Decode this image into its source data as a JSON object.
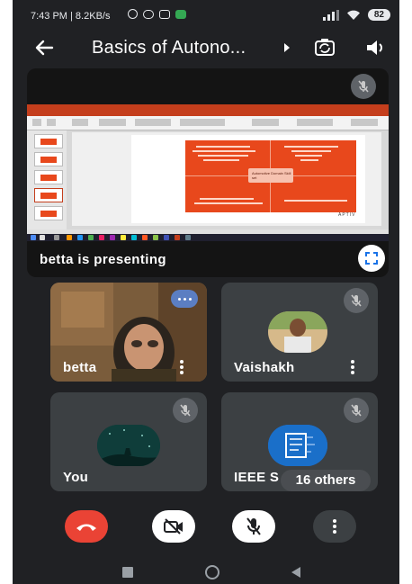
{
  "status_bar": {
    "time_speed": "7:43 PM | 8.2KB/s",
    "battery": "82"
  },
  "header": {
    "title": "Basics of Autono..."
  },
  "presenter_tile": {
    "label": "betta is presenting",
    "slide": {
      "center_text": "Automotive Domain Skill set",
      "footer": "APTIV"
    }
  },
  "participants": [
    {
      "name": "betta",
      "muted": false
    },
    {
      "name": "Vaishakh",
      "muted": true
    },
    {
      "name": "You",
      "muted": true
    },
    {
      "name": "IEEE S",
      "muted": true
    }
  ],
  "others_count": "16 others",
  "icons": {
    "back": "arrow-left-icon",
    "title_arrow": "play-arrow-icon",
    "switch_camera": "switch-camera-icon",
    "audio": "speaker-icon",
    "mute": "mic-off-icon",
    "fullscreen": "fullscreen-icon",
    "end_call": "phone-hangup-icon",
    "camera_off": "camera-off-icon",
    "mic_off": "mic-off-icon",
    "more": "more-vert-icon"
  },
  "colors": {
    "background": "#202124",
    "tile": "#3c4043",
    "end_call": "#ea4335",
    "slide_accent": "#e8481c",
    "avatar_teal": "#0f3d3a",
    "avatar_blue": "#1a73e8"
  }
}
